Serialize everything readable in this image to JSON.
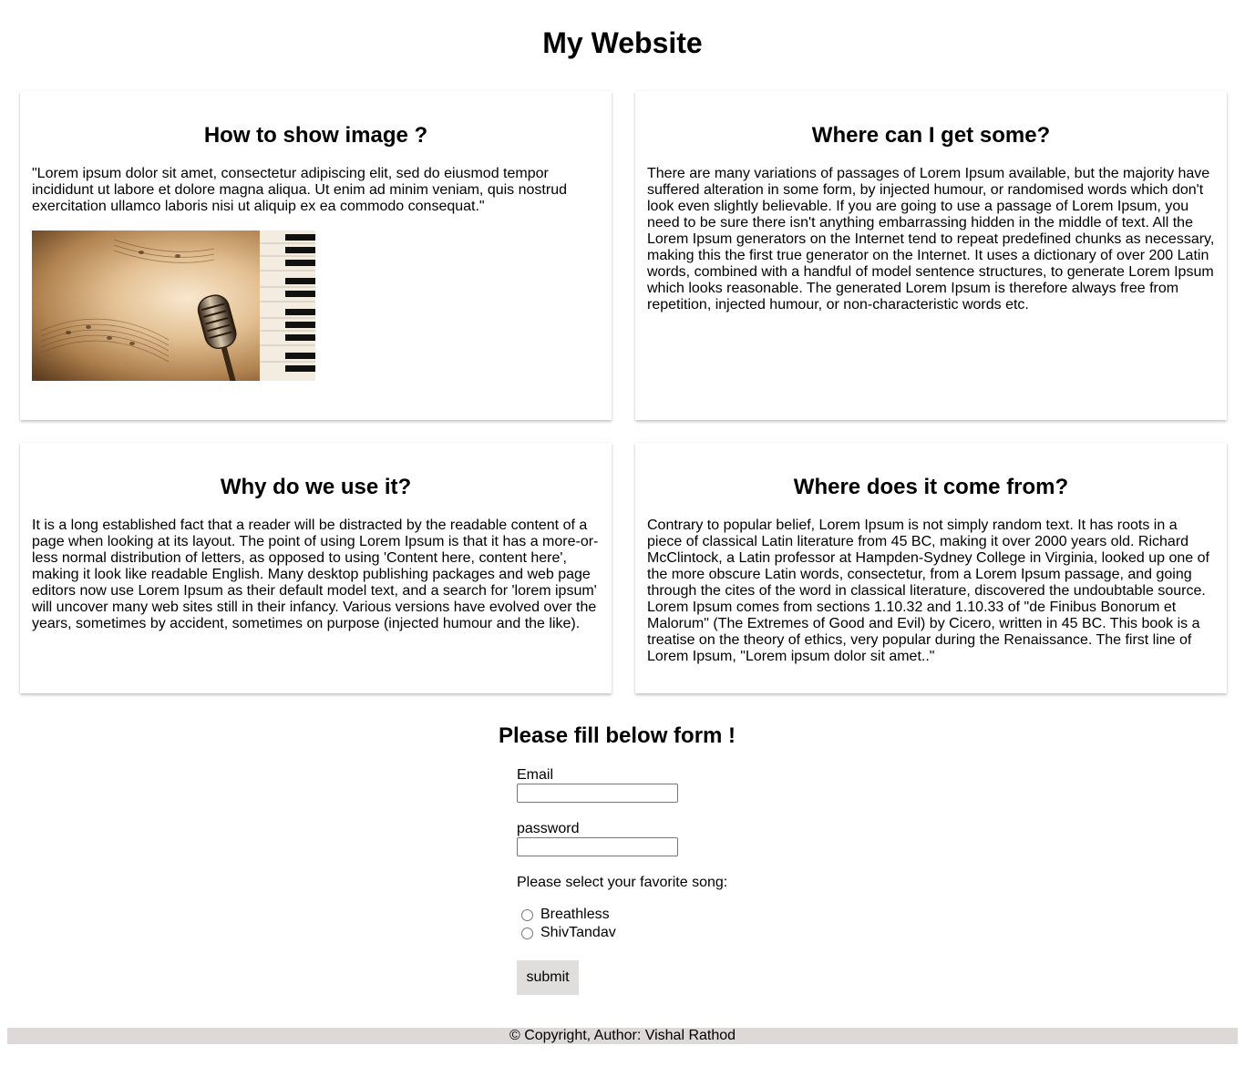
{
  "header": {
    "title": "My Website"
  },
  "cards": [
    {
      "title": "How to show image ?",
      "text": "\"Lorem ipsum dolor sit amet, consectetur adipiscing elit, sed do eiusmod tempor incididunt ut labore et dolore magna aliqua. Ut enim ad minim veniam, quis nostrud exercitation ullamco laboris nisi ut aliquip ex ea commodo consequat.\"",
      "image": "microphone-and-piano-image"
    },
    {
      "title": "Where can I get some?",
      "text": "There are many variations of passages of Lorem Ipsum available, but the majority have suffered alteration in some form, by injected humour, or randomised words which don't look even slightly believable. If you are going to use a passage of Lorem Ipsum, you need to be sure there isn't anything embarrassing hidden in the middle of text. All the Lorem Ipsum generators on the Internet tend to repeat predefined chunks as necessary, making this the first true generator on the Internet. It uses a dictionary of over 200 Latin words, combined with a handful of model sentence structures, to generate Lorem Ipsum which looks reasonable. The generated Lorem Ipsum is therefore always free from repetition, injected humour, or non-characteristic words etc."
    },
    {
      "title": "Why do we use it?",
      "text": "It is a long established fact that a reader will be distracted by the readable content of a page when looking at its layout. The point of using Lorem Ipsum is that it has a more-or-less normal distribution of letters, as opposed to using 'Content here, content here', making it look like readable English. Many desktop publishing packages and web page editors now use Lorem Ipsum as their default model text, and a search for 'lorem ipsum' will uncover many web sites still in their infancy. Various versions have evolved over the years, sometimes by accident, sometimes on purpose (injected humour and the like)."
    },
    {
      "title": "Where does it come from?",
      "text": "Contrary to popular belief, Lorem Ipsum is not simply random text. It has roots in a piece of classical Latin literature from 45 BC, making it over 2000 years old. Richard McClintock, a Latin professor at Hampden-Sydney College in Virginia, looked up one of the more obscure Latin words, consectetur, from a Lorem Ipsum passage, and going through the cites of the word in classical literature, discovered the undoubtable source. Lorem Ipsum comes from sections 1.10.32 and 1.10.33 of \"de Finibus Bonorum et Malorum\" (The Extremes of Good and Evil) by Cicero, written in 45 BC. This book is a treatise on the theory of ethics, very popular during the Renaissance. The first line of Lorem Ipsum, \"Lorem ipsum dolor sit amet..\""
    }
  ],
  "form": {
    "title": "Please fill below form !",
    "email_label": "Email",
    "email_value": "",
    "password_label": "password",
    "password_value": "",
    "song_prompt": "Please select your favorite song:",
    "song_options": [
      {
        "label": "Breathless",
        "selected": false
      },
      {
        "label": "ShivTandav",
        "selected": false
      }
    ],
    "submit_label": "submit"
  },
  "footer": {
    "text": "© Copyright, Author: Vishal Rathod"
  },
  "colors": {
    "button_bg": "#e0dddd",
    "footer_bg": "#ddd9d9"
  }
}
